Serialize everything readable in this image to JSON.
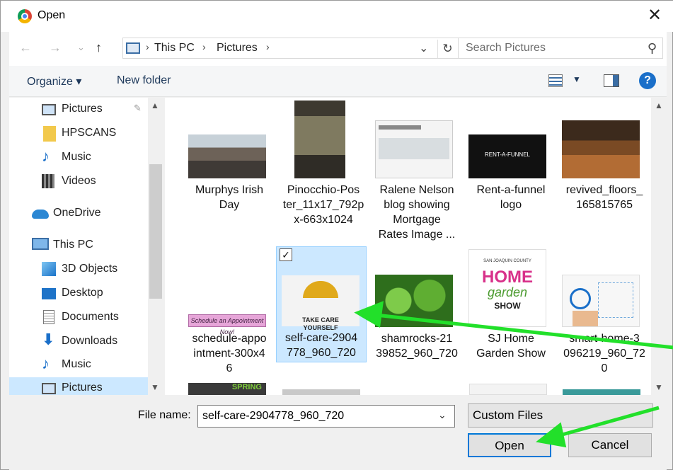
{
  "window": {
    "title": "Open",
    "close_glyph": "✕"
  },
  "nav": {
    "back": "←",
    "forward": "→",
    "recent": "⌄",
    "up": "↑"
  },
  "address": {
    "crumbs": [
      "This PC",
      "Pictures"
    ],
    "separator": "›",
    "dropdown": "⌄",
    "refresh": "↻"
  },
  "search": {
    "placeholder": "Search Pictures",
    "icon": "⚲"
  },
  "toolbar": {
    "organize": "Organize ▾",
    "new_folder": "New folder",
    "view_dd": "▼",
    "help": "?"
  },
  "sidebar": {
    "items": [
      {
        "label": "Pictures",
        "icon": "pictures-icon",
        "pin": "✎"
      },
      {
        "label": "HPSCANS",
        "icon": "folder-icon"
      },
      {
        "label": "Music",
        "icon": "music-icon"
      },
      {
        "label": "Videos",
        "icon": "videos-icon"
      },
      {
        "label": "OneDrive",
        "icon": "onedrive-icon"
      },
      {
        "label": "This PC",
        "icon": "pc-icon"
      },
      {
        "label": "3D Objects",
        "icon": "3d-objects-icon"
      },
      {
        "label": "Desktop",
        "icon": "desktop-icon"
      },
      {
        "label": "Documents",
        "icon": "documents-icon"
      },
      {
        "label": "Downloads",
        "icon": "downloads-icon"
      },
      {
        "label": "Music",
        "icon": "music-icon"
      },
      {
        "label": "Pictures",
        "icon": "pictures-icon",
        "selected": true
      }
    ],
    "scroll_up": "▲",
    "scroll_down": "▼"
  },
  "files": [
    {
      "name": "Murphys Irish\nDay"
    },
    {
      "name": "Pinocchio-Pos\nter_11x17_792p\nx-663x1024"
    },
    {
      "name": "Ralene Nelson\nblog showing\nMortgage\nRates Image ..."
    },
    {
      "name": "Rent-a-funnel\nlogo"
    },
    {
      "name": "revived_floors_\n165815765"
    },
    {
      "name": "schedule-appo\nintment-300x4\n6"
    },
    {
      "name": "self-care-2904\n778_960_720",
      "selected": true,
      "check": "✓"
    },
    {
      "name": "shamrocks-21\n39852_960_720"
    },
    {
      "name": "SJ Home\nGarden Show"
    },
    {
      "name": "smart-home-3\n096219_960_72\n0"
    }
  ],
  "thumb_text": {
    "rent": "RENT-A-FUNNEL",
    "schedule": "Schedule an Appointment Now!",
    "selfcare": "TAKE CARE\nYOURSELF",
    "sj_top": "SAN JOAQUIN COUNTY",
    "sj_home": "HOME",
    "sj_garden": "garden",
    "sj_show": "SHOW",
    "spring": "SPRING"
  },
  "footer": {
    "file_name_label": "File name:",
    "file_name_value": "self-care-2904778_960_720",
    "file_name_dd": "⌄",
    "file_type": "Custom Files",
    "open_label": "Open",
    "cancel_label": "Cancel"
  },
  "colors": {
    "accent": "#0078d7",
    "selection": "#cce8ff",
    "annotation_arrow": "#22e02a"
  }
}
